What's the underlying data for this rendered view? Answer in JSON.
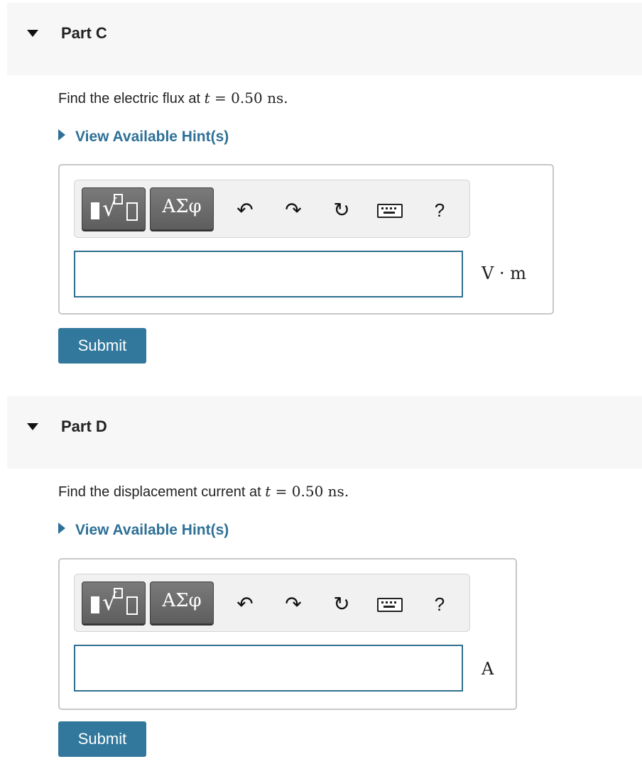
{
  "partC": {
    "title": "Part C",
    "question_text": "Find the electric flux at ",
    "question_var": "t",
    "question_eq": " = 0.50 ns.",
    "hint_label": "View Available Hint(s)",
    "toolbar": {
      "greek_label": "ΑΣφ",
      "help_label": "?"
    },
    "answer_value": "",
    "unit": "V · m",
    "submit_label": "Submit"
  },
  "partD": {
    "title": "Part D",
    "question_text": "Find the displacement current at ",
    "question_var": "t",
    "question_eq": " = 0.50 ns.",
    "hint_label": "View Available Hint(s)",
    "toolbar": {
      "greek_label": "ΑΣφ",
      "help_label": "?"
    },
    "answer_value": "",
    "unit": "A",
    "submit_label": "Submit"
  },
  "colors": {
    "accent": "#2e7097",
    "button": "#31789c",
    "header_bg": "#f7f7f7"
  },
  "icons": [
    "caret-down-icon",
    "triangle-right-icon",
    "templates-icon",
    "undo-icon",
    "redo-icon",
    "reset-icon",
    "keyboard-icon",
    "help-icon"
  ]
}
